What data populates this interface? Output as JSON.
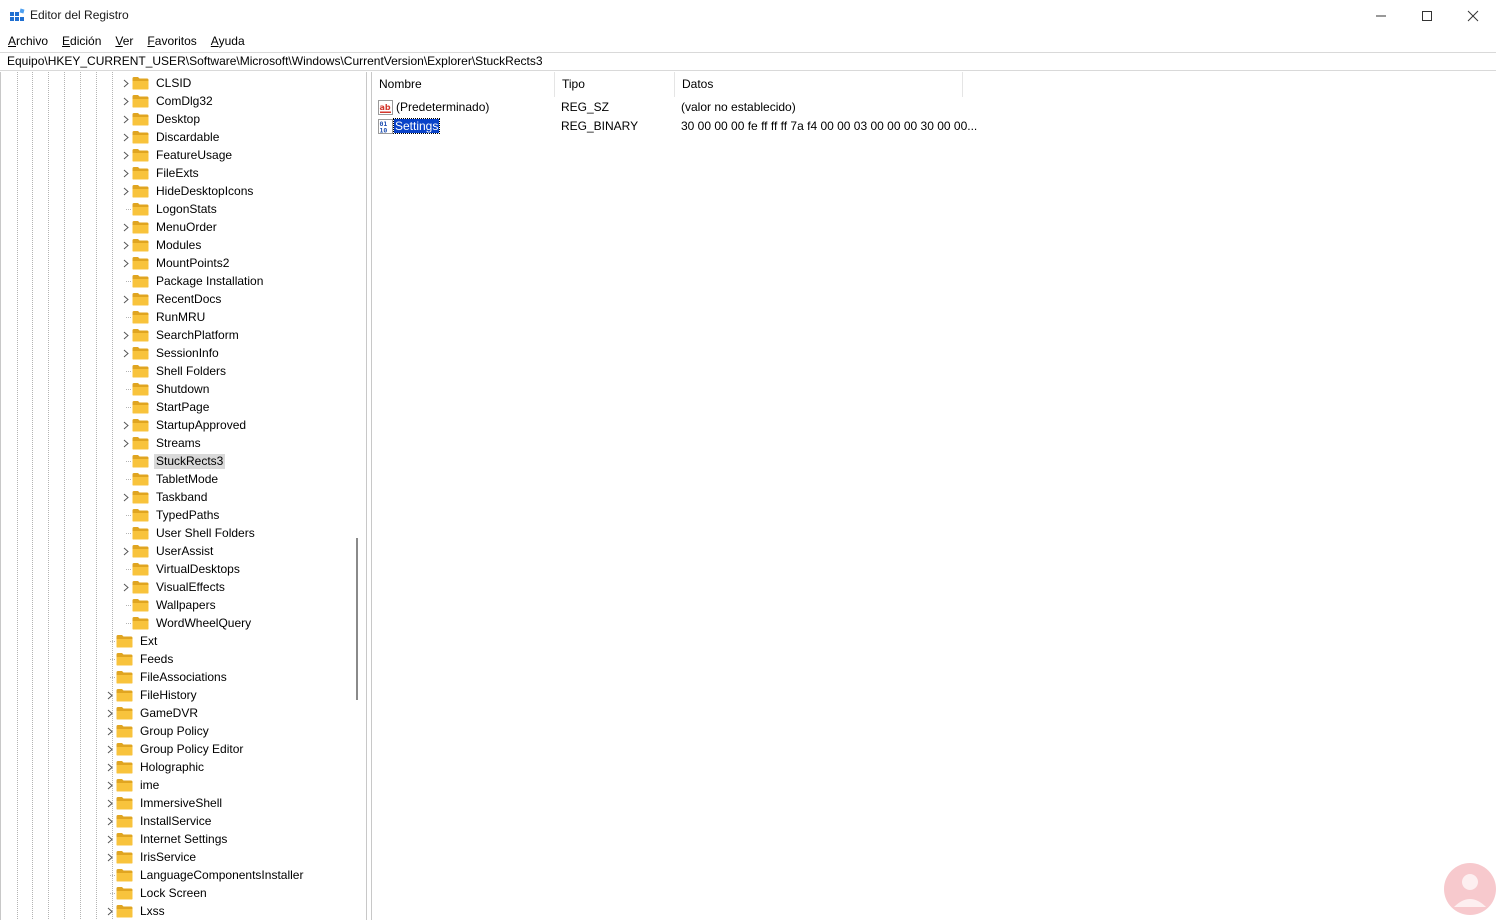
{
  "window": {
    "title": "Editor del Registro",
    "controls": {
      "minimize": "minimize-icon",
      "maximize": "maximize-icon",
      "close": "close-icon"
    }
  },
  "menu": {
    "items": [
      {
        "acc": "A",
        "rest": "rchivo"
      },
      {
        "acc": "E",
        "rest": "dición"
      },
      {
        "acc": "V",
        "rest": "er"
      },
      {
        "acc": "F",
        "rest": "avoritos"
      },
      {
        "acc": "A",
        "rest": "yuda"
      }
    ]
  },
  "address": "Equipo\\HKEY_CURRENT_USER\\Software\\Microsoft\\Windows\\CurrentVersion\\Explorer\\StuckRects3",
  "tree": {
    "items": [
      {
        "label": "CLSID",
        "expandable": true,
        "level": 2
      },
      {
        "label": "ComDlg32",
        "expandable": true,
        "level": 2
      },
      {
        "label": "Desktop",
        "expandable": true,
        "level": 2
      },
      {
        "label": "Discardable",
        "expandable": true,
        "level": 2
      },
      {
        "label": "FeatureUsage",
        "expandable": true,
        "level": 2
      },
      {
        "label": "FileExts",
        "expandable": true,
        "level": 2
      },
      {
        "label": "HideDesktopIcons",
        "expandable": true,
        "level": 2
      },
      {
        "label": "LogonStats",
        "expandable": false,
        "level": 2
      },
      {
        "label": "MenuOrder",
        "expandable": true,
        "level": 2
      },
      {
        "label": "Modules",
        "expandable": true,
        "level": 2
      },
      {
        "label": "MountPoints2",
        "expandable": true,
        "level": 2
      },
      {
        "label": "Package Installation",
        "expandable": false,
        "level": 2
      },
      {
        "label": "RecentDocs",
        "expandable": true,
        "level": 2
      },
      {
        "label": "RunMRU",
        "expandable": false,
        "level": 2
      },
      {
        "label": "SearchPlatform",
        "expandable": true,
        "level": 2
      },
      {
        "label": "SessionInfo",
        "expandable": true,
        "level": 2
      },
      {
        "label": "Shell Folders",
        "expandable": false,
        "level": 2
      },
      {
        "label": "Shutdown",
        "expandable": false,
        "level": 2
      },
      {
        "label": "StartPage",
        "expandable": false,
        "level": 2
      },
      {
        "label": "StartupApproved",
        "expandable": true,
        "level": 2
      },
      {
        "label": "Streams",
        "expandable": true,
        "level": 2
      },
      {
        "label": "StuckRects3",
        "expandable": false,
        "level": 2,
        "selected": true
      },
      {
        "label": "TabletMode",
        "expandable": false,
        "level": 2
      },
      {
        "label": "Taskband",
        "expandable": true,
        "level": 2
      },
      {
        "label": "TypedPaths",
        "expandable": false,
        "level": 2
      },
      {
        "label": "User Shell Folders",
        "expandable": false,
        "level": 2
      },
      {
        "label": "UserAssist",
        "expandable": true,
        "level": 2
      },
      {
        "label": "VirtualDesktops",
        "expandable": false,
        "level": 2
      },
      {
        "label": "VisualEffects",
        "expandable": true,
        "level": 2
      },
      {
        "label": "Wallpapers",
        "expandable": false,
        "level": 2
      },
      {
        "label": "WordWheelQuery",
        "expandable": false,
        "level": 2
      },
      {
        "label": "Ext",
        "expandable": false,
        "level": 1
      },
      {
        "label": "Feeds",
        "expandable": false,
        "level": 1
      },
      {
        "label": "FileAssociations",
        "expandable": false,
        "level": 1
      },
      {
        "label": "FileHistory",
        "expandable": true,
        "level": 1
      },
      {
        "label": "GameDVR",
        "expandable": true,
        "level": 1
      },
      {
        "label": "Group Policy",
        "expandable": true,
        "level": 1
      },
      {
        "label": "Group Policy Editor",
        "expandable": true,
        "level": 1
      },
      {
        "label": "Holographic",
        "expandable": true,
        "level": 1
      },
      {
        "label": "ime",
        "expandable": true,
        "level": 1
      },
      {
        "label": "ImmersiveShell",
        "expandable": true,
        "level": 1
      },
      {
        "label": "InstallService",
        "expandable": true,
        "level": 1
      },
      {
        "label": "Internet Settings",
        "expandable": true,
        "level": 1
      },
      {
        "label": "IrisService",
        "expandable": true,
        "level": 1
      },
      {
        "label": "LanguageComponentsInstaller",
        "expandable": false,
        "level": 1
      },
      {
        "label": "Lock Screen",
        "expandable": false,
        "level": 1
      },
      {
        "label": "Lxss",
        "expandable": true,
        "level": 1
      }
    ]
  },
  "values": {
    "columns": {
      "name": "Nombre",
      "type": "Tipo",
      "data": "Datos"
    },
    "rows": [
      {
        "name": "(Predeterminado)",
        "type": "REG_SZ",
        "data": "(valor no establecido)",
        "icon": "string-value-icon",
        "selected": false
      },
      {
        "name": "Settings",
        "type": "REG_BINARY",
        "data": "30 00 00 00 fe ff ff ff 7a f4 00 00 03 00 00 00 30 00 00...",
        "icon": "binary-value-icon",
        "selected": true
      }
    ]
  },
  "colors": {
    "folder": "#f8c33c",
    "folder_dark": "#e0a521",
    "selection": "#0a43c8",
    "tree_selection": "#d9d9d9",
    "watermark": "#e33d4b"
  }
}
